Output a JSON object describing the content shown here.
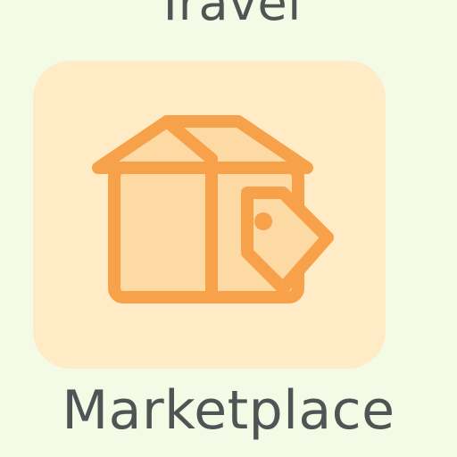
{
  "app": {
    "title_top": "Travel",
    "title_bottom": "Marketplace"
  },
  "icon": {
    "name": "box-with-price-tag-icon",
    "tile_color": "#ffebc6",
    "stroke_color": "#f7a24b",
    "fill_color": "#fdd9a4"
  },
  "colors": {
    "background": "#f3fbe6",
    "text": "#4e5554"
  }
}
